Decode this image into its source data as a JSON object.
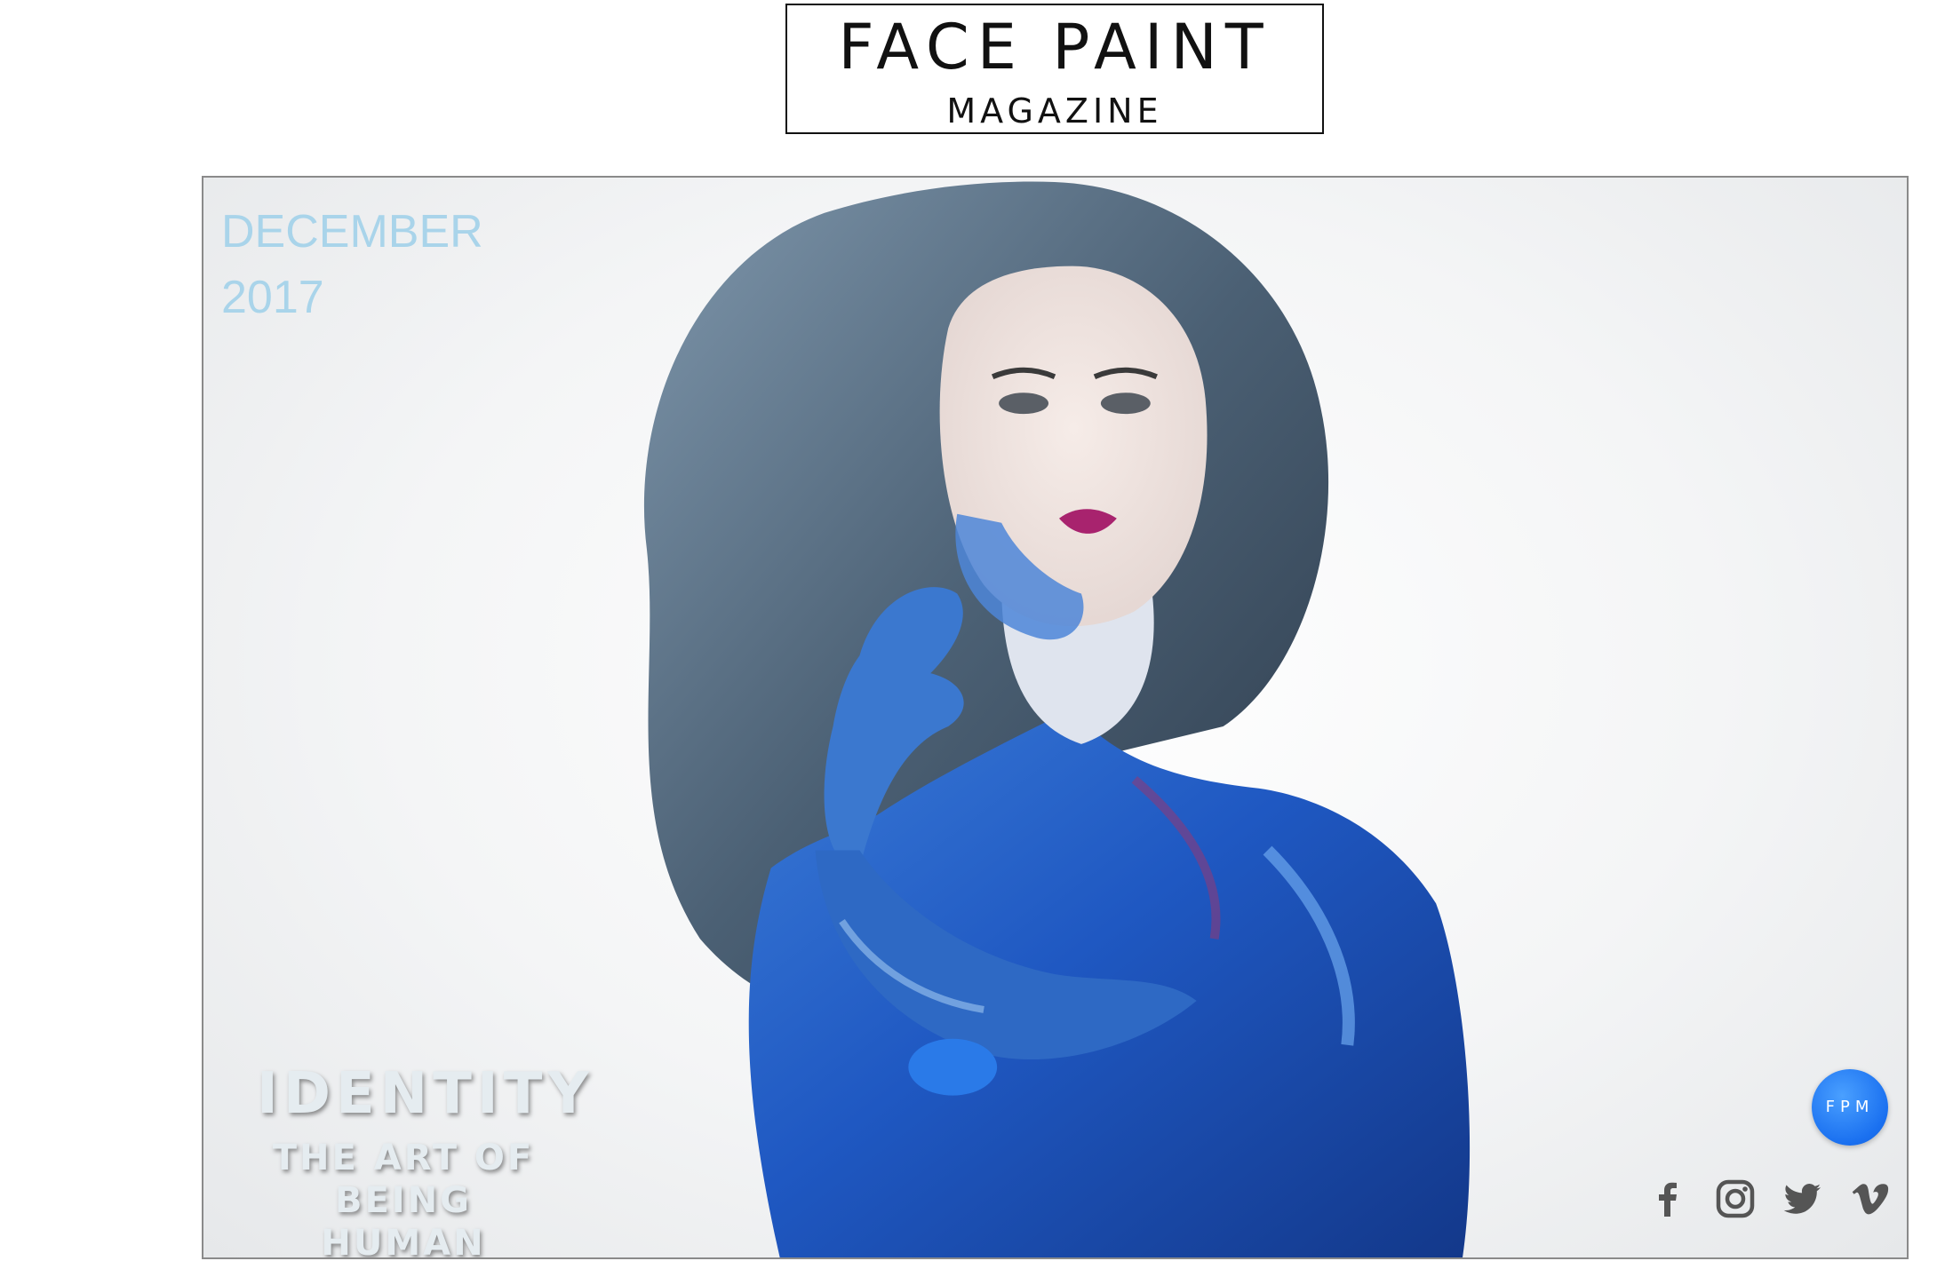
{
  "logo": {
    "title": "FACE PAINT",
    "subtitle": "MAGAZINE"
  },
  "cover": {
    "month": "DECEMBER",
    "year": "2017",
    "headline": "IDENTITY",
    "subheadline_line1": "THE ART OF",
    "subheadline_line2": "BEING HUMAN",
    "badge": "FPM",
    "accent_color": "#1a70f0",
    "date_color": "#a9d4ea"
  },
  "social": {
    "icons": [
      "facebook-icon",
      "instagram-icon",
      "twitter-icon",
      "vimeo-icon"
    ],
    "icon_color": "#555555"
  }
}
